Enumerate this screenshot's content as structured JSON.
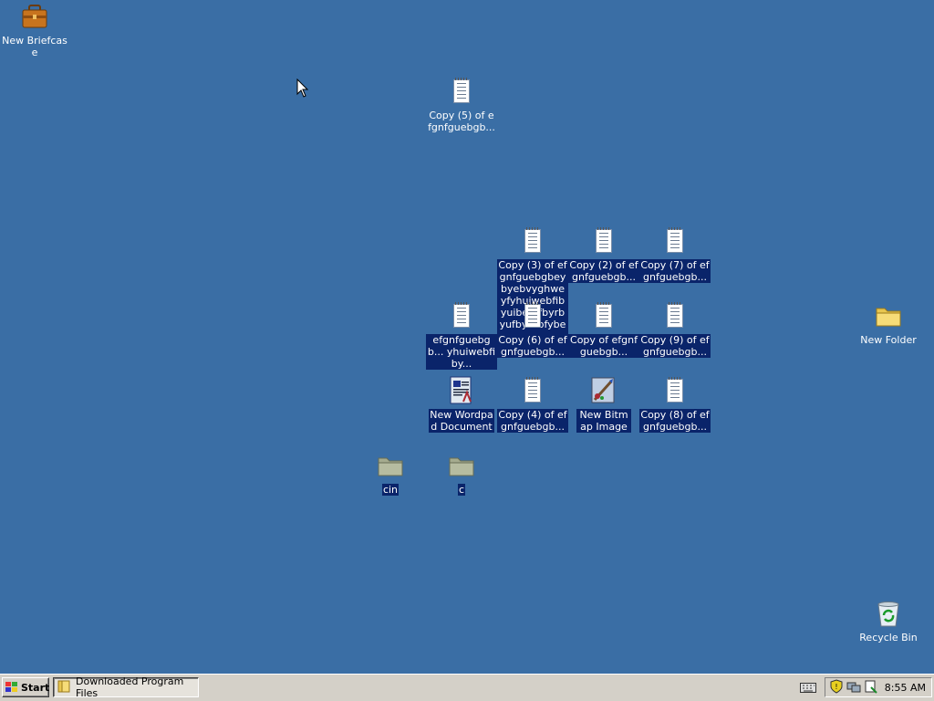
{
  "desktop": {
    "icons": [
      {
        "label": "New Briefcase"
      },
      {
        "label": "Copy (5) of efgnfguebgb..."
      },
      {
        "label": "Copy (3) of efgnfguebgbeybyebvyghweyfyhuiwebfibyuiberyfbyrbyufbyrebfybery"
      },
      {
        "label": "Copy (2) of efgnfguebgb..."
      },
      {
        "label": "Copy (7) of efgnfguebgb..."
      },
      {
        "label": "efgnfguebgb... yhuiwebfiby..."
      },
      {
        "label": "Copy (6) of efgnfguebgb..."
      },
      {
        "label": "Copy of efgnfguebgb..."
      },
      {
        "label": "Copy (9) of efgnfguebgb..."
      },
      {
        "label": "New Folder"
      },
      {
        "label": "New Wordpad Document"
      },
      {
        "label": "Copy (4) of efgnfguebgb..."
      },
      {
        "label": "New Bitmap Image"
      },
      {
        "label": "Copy (8) of efgnfguebgb..."
      },
      {
        "label": "cin"
      },
      {
        "label": "c"
      },
      {
        "label": "Recycle Bin"
      }
    ]
  },
  "taskbar": {
    "start_label": "Start",
    "tasks": [
      {
        "label": "Downloaded Program Files"
      }
    ],
    "clock": "8:55 AM"
  },
  "icons": {
    "briefcase": "briefcase-icon",
    "text_file": "text-document-icon",
    "folder": "folder-icon",
    "wordpad": "wordpad-icon",
    "bitmap": "paint-icon",
    "recycle": "recycle-bin-icon"
  },
  "colors": {
    "desktop_bg": "#3a6ea5",
    "selection": "#0a246a",
    "taskbar": "#d4d0c8"
  }
}
